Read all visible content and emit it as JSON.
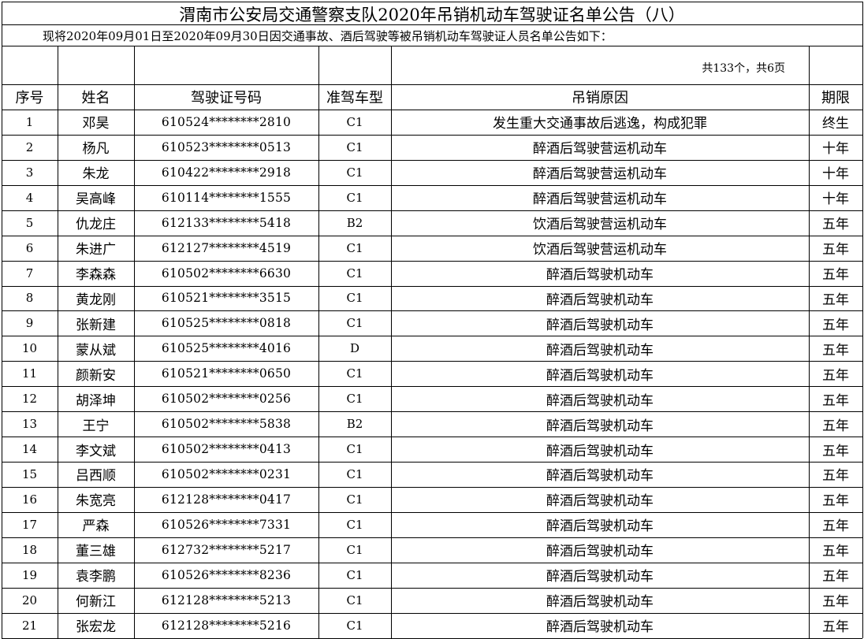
{
  "title": "渭南市公安局交通警察支队2020年吊销机动车驾驶证名单公告（八）",
  "subtitle": "现将2020年09月01日至2020年09月30日因交通事故、酒后驾驶等被吊销机动车驾驶证人员名单公告如下：",
  "count_text": "共133个，共6页",
  "headers": [
    "序号",
    "姓名",
    "驾驶证号码",
    "准驾车型",
    "吊销原因",
    "期限"
  ],
  "rows": [
    [
      "1",
      "邓昊",
      "610524********2810",
      "C1",
      "发生重大交通事故后逃逸，构成犯罪",
      "终生"
    ],
    [
      "2",
      "杨凡",
      "610523********0513",
      "C1",
      "醉酒后驾驶营运机动车",
      "十年"
    ],
    [
      "3",
      "朱龙",
      "610422********2918",
      "C1",
      "醉酒后驾驶营运机动车",
      "十年"
    ],
    [
      "4",
      "吴高峰",
      "610114********1555",
      "C1",
      "醉酒后驾驶营运机动车",
      "十年"
    ],
    [
      "5",
      "仇龙庄",
      "612133********5418",
      "B2",
      "饮酒后驾驶营运机动车",
      "五年"
    ],
    [
      "6",
      "朱进广",
      "612127********4519",
      "C1",
      "饮酒后驾驶营运机动车",
      "五年"
    ],
    [
      "7",
      "李森森",
      "610502********6630",
      "C1",
      "醉酒后驾驶机动车",
      "五年"
    ],
    [
      "8",
      "黄龙刚",
      "610521********3515",
      "C1",
      "醉酒后驾驶机动车",
      "五年"
    ],
    [
      "9",
      "张新建",
      "610525********0818",
      "C1",
      "醉酒后驾驶机动车",
      "五年"
    ],
    [
      "10",
      "蒙从斌",
      "610525********4016",
      "D",
      "醉酒后驾驶机动车",
      "五年"
    ],
    [
      "11",
      "颜新安",
      "610521********0650",
      "C1",
      "醉酒后驾驶机动车",
      "五年"
    ],
    [
      "12",
      "胡泽坤",
      "610502********0256",
      "C1",
      "醉酒后驾驶机动车",
      "五年"
    ],
    [
      "13",
      "王宁",
      "610502********5838",
      "B2",
      "醉酒后驾驶机动车",
      "五年"
    ],
    [
      "14",
      "李文斌",
      "610502********0413",
      "C1",
      "醉酒后驾驶机动车",
      "五年"
    ],
    [
      "15",
      "吕西顺",
      "610502********0231",
      "C1",
      "醉酒后驾驶机动车",
      "五年"
    ],
    [
      "16",
      "朱宽亮",
      "612128********0417",
      "C1",
      "醉酒后驾驶机动车",
      "五年"
    ],
    [
      "17",
      "严森",
      "610526********7331",
      "C1",
      "醉酒后驾驶机动车",
      "五年"
    ],
    [
      "18",
      "董三雄",
      "612732********5217",
      "C1",
      "醉酒后驾驶机动车",
      "五年"
    ],
    [
      "19",
      "袁李鹏",
      "610526********8236",
      "C1",
      "醉酒后驾驶机动车",
      "五年"
    ],
    [
      "20",
      "何新江",
      "612128********5213",
      "C1",
      "醉酒后驾驶机动车",
      "五年"
    ],
    [
      "21",
      "张宏龙",
      "612128********5216",
      "C1",
      "醉酒后驾驶机动车",
      "五年"
    ]
  ]
}
